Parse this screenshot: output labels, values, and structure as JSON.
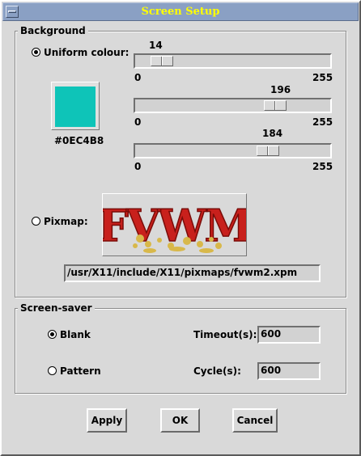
{
  "window": {
    "title": "Screen Setup"
  },
  "background": {
    "legend": "Background",
    "uniform_label": "Uniform colour:",
    "uniform_selected": true,
    "swatch_color": "#0EC4B8",
    "color_hex": "#0EC4B8",
    "sliders": [
      {
        "name": "red",
        "value": "14",
        "value_num": 14,
        "min": "0",
        "max": "255"
      },
      {
        "name": "green",
        "value": "196",
        "value_num": 196,
        "min": "0",
        "max": "255"
      },
      {
        "name": "blue",
        "value": "184",
        "value_num": 184,
        "min": "0",
        "max": "255"
      }
    ],
    "pixmap_label": "Pixmap:",
    "pixmap_selected": false,
    "pixmap_logo_text": "FVWM",
    "pixmap_path": "/usr/X11/include/X11/pixmaps/fvwm2.xpm"
  },
  "screensaver": {
    "legend": "Screen-saver",
    "blank_label": "Blank",
    "blank_selected": true,
    "pattern_label": "Pattern",
    "pattern_selected": false,
    "timeout_label": "Timeout(s):",
    "timeout_value": "600",
    "cycle_label": "Cycle(s):",
    "cycle_value": "600"
  },
  "buttons": {
    "apply": "Apply",
    "ok": "OK",
    "cancel": "Cancel"
  },
  "colors": {
    "title_bg": "#8aa0c4",
    "title_fg": "#ffff00",
    "logo_red": "#c8201c",
    "logo_gold": "#d8b84a"
  }
}
